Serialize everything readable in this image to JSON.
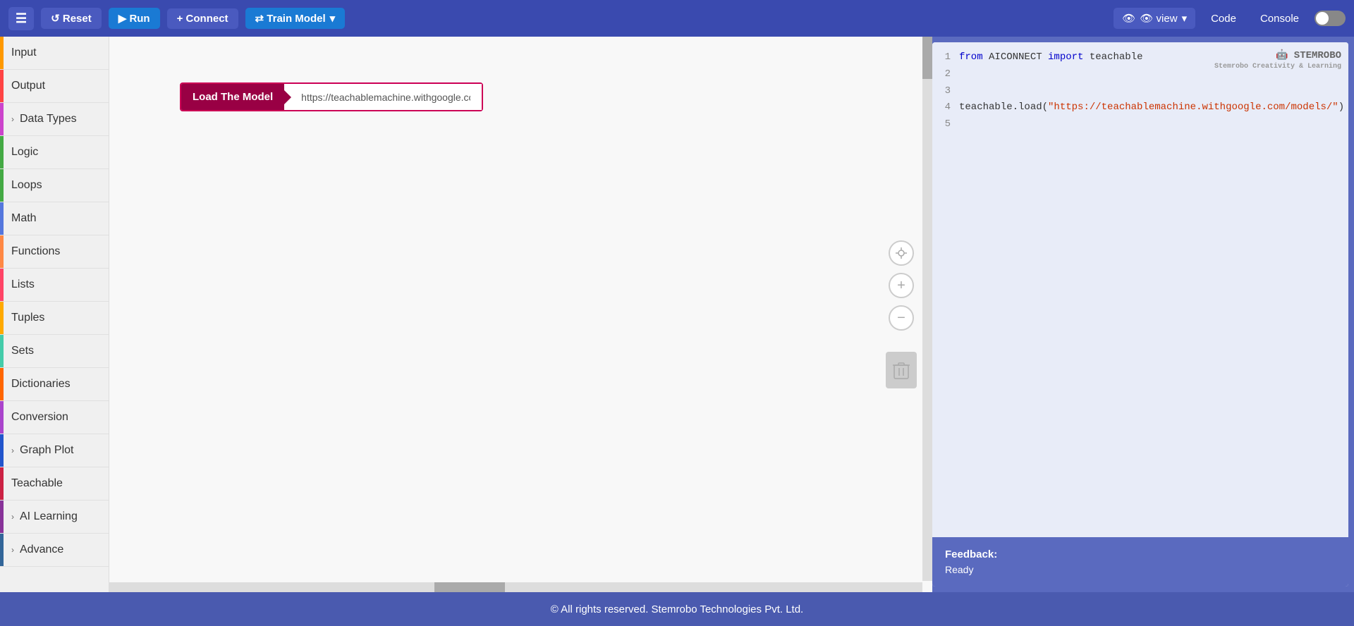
{
  "toolbar": {
    "menu_label": "☰",
    "reset_label": "↺ Reset",
    "run_label": "▶ Run",
    "connect_label": "+ Connect",
    "train_label": "⇄ Train Model",
    "train_arrow": "▾",
    "view_label": "👁 view",
    "view_arrow": "▾",
    "code_label": "Code",
    "console_label": "Console"
  },
  "sidebar": {
    "items": [
      {
        "label": "Input",
        "color": "input",
        "chevron": false
      },
      {
        "label": "Output",
        "color": "output",
        "chevron": false
      },
      {
        "label": "Data Types",
        "color": "datatypes",
        "chevron": true
      },
      {
        "label": "Logic",
        "color": "logic",
        "chevron": false
      },
      {
        "label": "Loops",
        "color": "loops",
        "chevron": false
      },
      {
        "label": "Math",
        "color": "math",
        "chevron": false
      },
      {
        "label": "Functions",
        "color": "functions",
        "chevron": false
      },
      {
        "label": "Lists",
        "color": "lists",
        "chevron": false
      },
      {
        "label": "Tuples",
        "color": "tuples",
        "chevron": false
      },
      {
        "label": "Sets",
        "color": "sets",
        "chevron": false
      },
      {
        "label": "Dictionaries",
        "color": "dicts",
        "chevron": false
      },
      {
        "label": "Conversion",
        "color": "conversion",
        "chevron": false
      },
      {
        "label": "Graph Plot",
        "color": "graphplot",
        "chevron": true
      },
      {
        "label": "Teachable",
        "color": "teachable",
        "chevron": false
      },
      {
        "label": "AI Learning",
        "color": "ailearning",
        "chevron": true
      },
      {
        "label": "Advance",
        "color": "advance",
        "chevron": true
      }
    ]
  },
  "canvas": {
    "block": {
      "label": "Load The Model",
      "input_value": "https://teachablemachine.withgoogle.co..."
    }
  },
  "code": {
    "lines": [
      {
        "num": "1",
        "content": "from AICONNECT import teachable"
      },
      {
        "num": "2",
        "content": ""
      },
      {
        "num": "3",
        "content": ""
      },
      {
        "num": "4",
        "content": "teachable.load(\"https://teachablemachine.withgoogle.com/models/\")"
      },
      {
        "num": "5",
        "content": ""
      }
    ]
  },
  "feedback": {
    "label": "Feedback:",
    "value": "Ready"
  },
  "footer": {
    "text": "© All rights reserved. Stemrobo Technologies Pvt. Ltd."
  }
}
